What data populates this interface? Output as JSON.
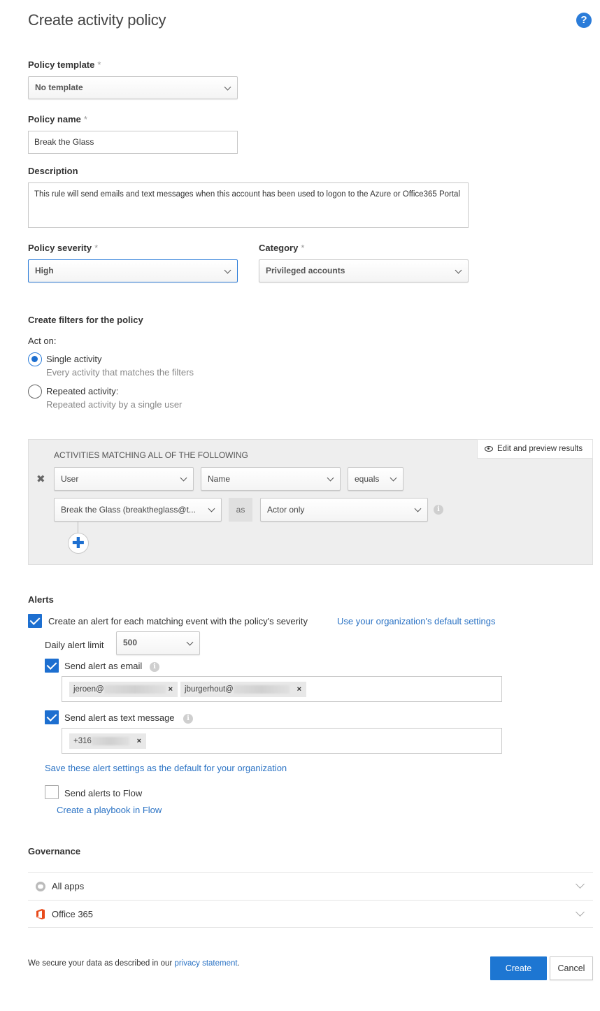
{
  "header": {
    "title": "Create activity policy",
    "help_icon": "question-circle-icon",
    "help_glyph": "?"
  },
  "form": {
    "policy_template": {
      "label": "Policy template",
      "required_mark": "*",
      "value": "No template"
    },
    "policy_name": {
      "label": "Policy name",
      "required_mark": "*",
      "value": "Break the Glass"
    },
    "description": {
      "label": "Description",
      "value": "This rule will send emails and text messages when this account has been used to logon to the Azure or Office365 Portal"
    },
    "policy_severity": {
      "label": "Policy severity",
      "required_mark": "*",
      "value": "High"
    },
    "category": {
      "label": "Category",
      "required_mark": "*",
      "value": "Privileged accounts"
    }
  },
  "filters": {
    "heading": "Create filters for the policy",
    "act_on_label": "Act on:",
    "options": [
      {
        "label": "Single activity",
        "sub": "Every activity that matches the filters",
        "selected": true
      },
      {
        "label": "Repeated activity:",
        "sub": "Repeated activity by a single user",
        "selected": false
      }
    ],
    "box": {
      "heading": "ACTIVITIES MATCHING ALL OF THE FOLLOWING",
      "edit_preview_label": "Edit and preview results",
      "remove_glyph": "✖",
      "row1": {
        "field": "User",
        "subfield": "Name",
        "operator": "equals"
      },
      "row2": {
        "value": "Break the Glass (breaktheglass@t...",
        "as_label": "as",
        "role": "Actor only"
      },
      "add_glyph": "✚",
      "info_glyph": "i"
    }
  },
  "alerts": {
    "heading": "Alerts",
    "create_alert": {
      "label": "Create an alert for each matching event with the policy's severity",
      "checked": true
    },
    "default_settings_link": "Use your organization's default settings",
    "daily_limit": {
      "label": "Daily alert limit",
      "value": "500"
    },
    "email": {
      "label": "Send alert as email",
      "checked": true,
      "recipients": [
        {
          "prefix": "jeroen@",
          "remove": "×"
        },
        {
          "prefix": "jburgerhout@",
          "remove": "×"
        }
      ]
    },
    "sms": {
      "label": "Send alert as text message",
      "checked": true,
      "recipients": [
        {
          "prefix": "+316",
          "remove": "×"
        }
      ]
    },
    "save_default_link": "Save these alert settings as the default for your organization",
    "flow": {
      "label": "Send alerts to Flow",
      "checked": false
    },
    "flow_link": "Create a playbook in Flow",
    "info_glyph": "i"
  },
  "governance": {
    "heading": "Governance",
    "rows": [
      {
        "label": "All apps",
        "icon": "cloud-icon"
      },
      {
        "label": "Office 365",
        "icon": "office365-icon"
      }
    ]
  },
  "footer": {
    "privacy_text": "We secure your data as described in our ",
    "privacy_link": "privacy statement",
    "privacy_end": ".",
    "create_label": "Create",
    "cancel_label": "Cancel"
  },
  "colors": {
    "accent": "#1d76d2",
    "link": "#2a72c4",
    "office_orange": "#e84a1a"
  }
}
